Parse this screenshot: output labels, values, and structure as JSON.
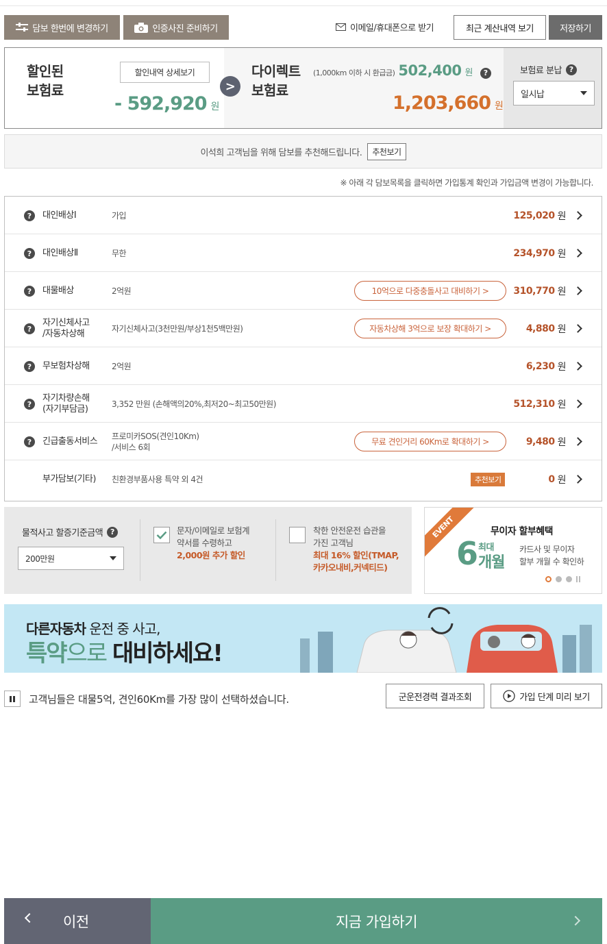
{
  "toolbar": {
    "change_coverage": "담보 한번에 변경하기",
    "prepare_photo": "인증사진 준비하기",
    "email_sms": "이메일/휴대폰으로 받기",
    "recent_calc": "최근 계산내역 보기",
    "save": "저장하기"
  },
  "summary": {
    "discount_title_1": "할인된",
    "discount_title_2": "보험료",
    "discount_detail_btn": "할인내역 상세보기",
    "discount_amount": "- 592,920",
    "won": "원",
    "direct_title_1": "다이렉트",
    "direct_title_2": "보험료",
    "refund_note": "(1,000km 이하 시 환급금)",
    "refund_amount": "502,400",
    "direct_amount": "1,203,660",
    "installment_label": "보험료 분납",
    "installment_value": "일시납"
  },
  "recommend": {
    "text": "이석희 고객님을 위해 담보를 추천해드립니다.",
    "button": "추천보기"
  },
  "note": "※ 아래 각 담보목록을 클릭하면 가입통계 확인과 가입금액 변경이 가능합니다.",
  "coverages": [
    {
      "name": "대인배상Ⅰ",
      "detail": "가입",
      "promo": "",
      "price": "125,020"
    },
    {
      "name": "대인배상Ⅱ",
      "detail": "무한",
      "promo": "",
      "price": "234,970"
    },
    {
      "name": "대물배상",
      "detail": "2억원",
      "promo": "10억으로 다중충돌사고 대비하기 >",
      "price": "310,770"
    },
    {
      "name": "자기신체사고\n/자동차상해",
      "detail": "자기신체사고(3천만원/부상1천5백만원)",
      "promo": "자동차상해 3억으로 보장 확대하기 >",
      "price": "4,880"
    },
    {
      "name": "무보험차상해",
      "detail": "2억원",
      "promo": "",
      "price": "6,230"
    },
    {
      "name": "자기차량손해\n(자기부담금)",
      "detail": "3,352 만원 (손해액의20%,최저20~최고50만원)",
      "promo": "",
      "price": "512,310"
    },
    {
      "name": "긴급출동서비스",
      "detail": "프로미카SOS(견인10Km)\n/서비스 6회",
      "promo": "무료 견인거리 60Km로 확대하기 >",
      "price": "9,480"
    },
    {
      "name": "부가담보(기타)",
      "detail": "친환경부품사용 특약 외 4건",
      "promo": "",
      "tag": "추천보기",
      "price": "0"
    }
  ],
  "options": {
    "property_label": "물적사고 할증기준금액",
    "property_value": "200만원",
    "opt1_text_1": "문자/이메일로 보험계",
    "opt1_text_2": "약서를 수령하고",
    "opt1_highlight": "2,000원 추가 할인",
    "opt2_text_1": "착한 안전운전 습관을",
    "opt2_text_2": "가진 고객님",
    "opt2_highlight_1": "최대 16% 할인(TMAP,",
    "opt2_highlight_2": "카카오내비,커넥티드)"
  },
  "event": {
    "ribbon": "EVENT",
    "title": "무이자 할부혜택",
    "big_num": "6",
    "max": "최대",
    "months": "개월",
    "desc_1": "카드사 및 무이자",
    "desc_2": "할부 개월 수 확인하"
  },
  "banner": {
    "line1_bold": "다른자동차",
    "line1_rest": " 운전 중 사고,",
    "line2_a": "특약",
    "line2_b": "으로 ",
    "line2_c": "대비",
    "line2_d": "하세요!"
  },
  "info": {
    "text": "고객님들은 대물5억, 견인60Km를 가장 많이 선택하셨습니다.",
    "military": "군운전경력 결과조회",
    "preview": "가입 단계 미리 보기"
  },
  "footer": {
    "prev": "이전",
    "join": "지금 가입하기"
  },
  "colors": {
    "green": "#5a9c84",
    "orange": "#d4702c",
    "brown": "#8e8378",
    "navy": "#626573"
  }
}
